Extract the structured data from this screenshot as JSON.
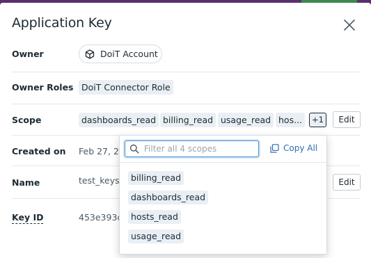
{
  "modal": {
    "title": "Application Key"
  },
  "fields": {
    "owner": {
      "label": "Owner",
      "value": "DoiT Account"
    },
    "owner_roles": {
      "label": "Owner Roles",
      "value": "DoiT Connector Role"
    },
    "scope": {
      "label": "Scope",
      "tags": [
        "dashboards_read",
        "billing_read",
        "usage_read",
        "hos..."
      ],
      "more_label": "+1",
      "edit_label": "Edit"
    },
    "created_on": {
      "label": "Created on",
      "value": "Feb 27, 20"
    },
    "name": {
      "label": "Name",
      "value": "test_keys",
      "edit_label": "Edit"
    },
    "key_id": {
      "label": "Key ID",
      "value": "453e393c"
    }
  },
  "scope_popover": {
    "search_placeholder": "Filter all 4 scopes",
    "search_value": "",
    "copy_all_label": "Copy All",
    "items": [
      "billing_read",
      "dashboards_read",
      "hosts_read",
      "usage_read"
    ]
  },
  "colors": {
    "tag_bg": "#e9eff4",
    "link": "#2f6db3",
    "focus_border": "#4b90c8",
    "backdrop": "#5a2f6e"
  },
  "icons": {
    "close": "close-icon",
    "owner": "cube-icon",
    "search": "search-icon",
    "copy": "copy-icon"
  }
}
